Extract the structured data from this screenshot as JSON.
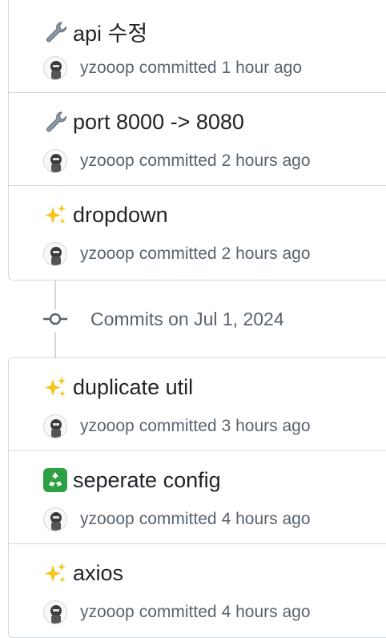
{
  "groups": [
    {
      "commits": [
        {
          "emoji": "wrench-icon",
          "title": "api 수정",
          "author": "yzooop",
          "verb": "committed",
          "time": "1 hour ago"
        },
        {
          "emoji": "wrench-icon",
          "title": "port 8000 -> 8080",
          "author": "yzooop",
          "verb": "committed",
          "time": "2 hours ago"
        },
        {
          "emoji": "sparkles-icon",
          "title": "dropdown",
          "author": "yzooop",
          "verb": "committed",
          "time": "2 hours ago"
        }
      ]
    },
    {
      "heading": "Commits on Jul 1, 2024",
      "commits": [
        {
          "emoji": "sparkles-icon",
          "title": "duplicate util",
          "author": "yzooop",
          "verb": "committed",
          "time": "3 hours ago"
        },
        {
          "emoji": "recycle-icon",
          "title": "seperate config",
          "author": "yzooop",
          "verb": "committed",
          "time": "4 hours ago"
        },
        {
          "emoji": "sparkles-icon",
          "title": "axios",
          "author": "yzooop",
          "verb": "committed",
          "time": "4 hours ago"
        }
      ]
    }
  ],
  "colors": {
    "border": "#d1d9e0",
    "muted_text": "#59636e",
    "title_text": "#1f2328",
    "recycle_green": "#2ea043",
    "sparkle_yellow": "#f5c518"
  }
}
